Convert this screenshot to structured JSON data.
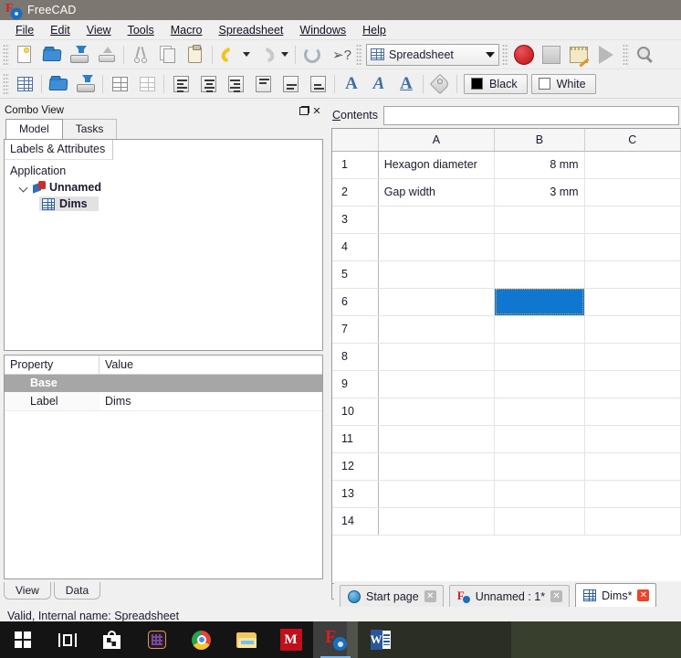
{
  "window": {
    "title": "FreeCAD",
    "logo_icon": "freecad-logo-icon"
  },
  "menubar": {
    "items": [
      {
        "label": "File",
        "mnemonic": "F"
      },
      {
        "label": "Edit",
        "mnemonic": "E"
      },
      {
        "label": "View",
        "mnemonic": "V"
      },
      {
        "label": "Tools",
        "mnemonic": "T"
      },
      {
        "label": "Macro",
        "mnemonic": "M"
      },
      {
        "label": "Spreadsheet",
        "mnemonic": "S"
      },
      {
        "label": "Windows",
        "mnemonic": "W"
      },
      {
        "label": "Help",
        "mnemonic": "H"
      }
    ]
  },
  "toolbar_file": {
    "buttons": [
      {
        "name": "new-document-button",
        "icon": "new-page-icon"
      },
      {
        "name": "open-document-button",
        "icon": "open-folder-icon"
      },
      {
        "name": "save-document-button",
        "icon": "save-disk-icon"
      },
      {
        "name": "print-button",
        "icon": "printer-icon"
      },
      {
        "name": "cut-button",
        "icon": "scissors-icon"
      },
      {
        "name": "copy-button",
        "icon": "copy-pages-icon"
      },
      {
        "name": "paste-button",
        "icon": "clipboard-icon"
      },
      {
        "name": "undo-button",
        "icon": "undo-arrow-icon"
      },
      {
        "name": "undo-dropdown",
        "icon": "chevron-down-icon"
      },
      {
        "name": "redo-button",
        "icon": "redo-arrow-icon"
      },
      {
        "name": "redo-dropdown",
        "icon": "chevron-down-icon"
      },
      {
        "name": "refresh-button",
        "icon": "refresh-icon"
      },
      {
        "name": "whats-this-button",
        "icon": "cursor-question-icon"
      }
    ]
  },
  "workbench_selector": {
    "value": "Spreadsheet",
    "icon": "spreadsheet-icon",
    "caret_icon": "chevron-down-icon"
  },
  "toolbar_macro": {
    "buttons": [
      {
        "name": "macro-record-button",
        "icon": "record-circle-icon"
      },
      {
        "name": "macro-stop-button",
        "icon": "stop-square-icon"
      },
      {
        "name": "macro-edit-button",
        "icon": "notepad-pencil-icon"
      },
      {
        "name": "macro-execute-button",
        "icon": "play-triangle-icon"
      }
    ]
  },
  "toolbar_view": {
    "buttons": [
      {
        "name": "fit-all-button",
        "icon": "magnifier-icon"
      }
    ]
  },
  "toolbar_spreadsheet": {
    "buttons": [
      {
        "name": "create-spreadsheet-button",
        "icon": "spreadsheet-grid-icon"
      },
      {
        "name": "import-spreadsheet-button",
        "icon": "import-folder-icon"
      },
      {
        "name": "export-spreadsheet-button",
        "icon": "export-disk-icon"
      },
      {
        "name": "merge-cells-button",
        "icon": "merge-cells-icon"
      },
      {
        "name": "split-cell-button",
        "icon": "split-cell-icon"
      },
      {
        "name": "align-left-button",
        "icon": "align-left-icon"
      },
      {
        "name": "align-center-button",
        "icon": "align-center-icon"
      },
      {
        "name": "align-right-button",
        "icon": "align-right-icon"
      },
      {
        "name": "align-top-button",
        "icon": "align-top-icon"
      },
      {
        "name": "align-vcenter-button",
        "icon": "align-vcenter-icon"
      },
      {
        "name": "align-bottom-button",
        "icon": "align-bottom-icon"
      },
      {
        "name": "style-bold-button",
        "icon": "bold-a-icon",
        "glyph": "A"
      },
      {
        "name": "style-italic-button",
        "icon": "italic-a-icon",
        "glyph": "A"
      },
      {
        "name": "style-underline-button",
        "icon": "underline-a-icon",
        "glyph": "A"
      },
      {
        "name": "set-alias-button",
        "icon": "tag-icon"
      }
    ],
    "foreground_color": {
      "label": "Black",
      "swatch": "#000000"
    },
    "background_color": {
      "label": "White",
      "swatch": "#ffffff"
    }
  },
  "combo_view": {
    "title": "Combo View",
    "float_icon": "float-window-icon",
    "close_icon": "close-icon",
    "tabs": [
      {
        "label": "Model",
        "active": true
      },
      {
        "label": "Tasks",
        "active": false
      }
    ],
    "tree": {
      "header": "Labels & Attributes",
      "root": "Application",
      "document": {
        "label": "Unnamed",
        "icon": "document-icon",
        "twisty": "chevron-down-icon"
      },
      "child": {
        "label": "Dims",
        "icon": "spreadsheet-object-icon",
        "selected": true
      }
    },
    "properties": {
      "headers": [
        "Property",
        "Value"
      ],
      "group": "Base",
      "rows": [
        {
          "property": "Label",
          "value": "Dims"
        }
      ]
    },
    "bottom_tabs": [
      {
        "label": "View",
        "active": false
      },
      {
        "label": "Data",
        "active": true
      }
    ]
  },
  "spreadsheet": {
    "contents_label": "Contents",
    "contents_mnemonic": "C",
    "contents_value": "",
    "columns": [
      "A",
      "B",
      "C"
    ],
    "rows": [
      {
        "number": "1",
        "A": "Hexagon diameter",
        "B": "8 mm",
        "C": ""
      },
      {
        "number": "2",
        "A": "Gap width",
        "B": "3 mm",
        "C": ""
      },
      {
        "number": "3",
        "A": "",
        "B": "",
        "C": ""
      },
      {
        "number": "4",
        "A": "",
        "B": "",
        "C": ""
      },
      {
        "number": "5",
        "A": "",
        "B": "",
        "C": ""
      },
      {
        "number": "6",
        "A": "",
        "B": "",
        "C": ""
      },
      {
        "number": "7",
        "A": "",
        "B": "",
        "C": ""
      },
      {
        "number": "8",
        "A": "",
        "B": "",
        "C": ""
      },
      {
        "number": "9",
        "A": "",
        "B": "",
        "C": ""
      },
      {
        "number": "10",
        "A": "",
        "B": "",
        "C": ""
      },
      {
        "number": "11",
        "A": "",
        "B": "",
        "C": ""
      },
      {
        "number": "12",
        "A": "",
        "B": "",
        "C": ""
      },
      {
        "number": "13",
        "A": "",
        "B": "",
        "C": ""
      },
      {
        "number": "14",
        "A": "",
        "B": "",
        "C": ""
      }
    ],
    "selected_cell": "B6",
    "selection_color": "#1077d1",
    "hscroll_left_arrow": "chevron-left-icon"
  },
  "document_tabs": [
    {
      "label": "Start page",
      "icon": "globe-icon",
      "close_icon": "close-icon",
      "active": false
    },
    {
      "label": "Unnamed : 1*",
      "icon": "freecad-logo-icon",
      "close_icon": "close-icon",
      "active": false
    },
    {
      "label": "Dims*",
      "icon": "spreadsheet-icon",
      "close_icon": "close-icon",
      "active": true
    }
  ],
  "statusbar": {
    "message": "Valid, Internal name: Spreadsheet"
  },
  "taskbar": {
    "items": [
      {
        "name": "start-button",
        "icon": "windows-logo-icon"
      },
      {
        "name": "task-view-button",
        "icon": "task-view-icon"
      },
      {
        "name": "microsoft-store-button",
        "icon": "store-bag-icon"
      },
      {
        "name": "purple-app-button",
        "icon": "purple-grid-icon"
      },
      {
        "name": "chrome-button",
        "icon": "chrome-icon"
      },
      {
        "name": "file-explorer-button",
        "icon": "folder-icon"
      },
      {
        "name": "m-app-button",
        "icon": "m-letter-icon",
        "glyph": "M"
      },
      {
        "name": "freecad-taskbar-button",
        "icon": "freecad-logo-icon",
        "active": true
      },
      {
        "name": "word-button",
        "icon": "word-icon",
        "glyph": "W"
      }
    ]
  }
}
